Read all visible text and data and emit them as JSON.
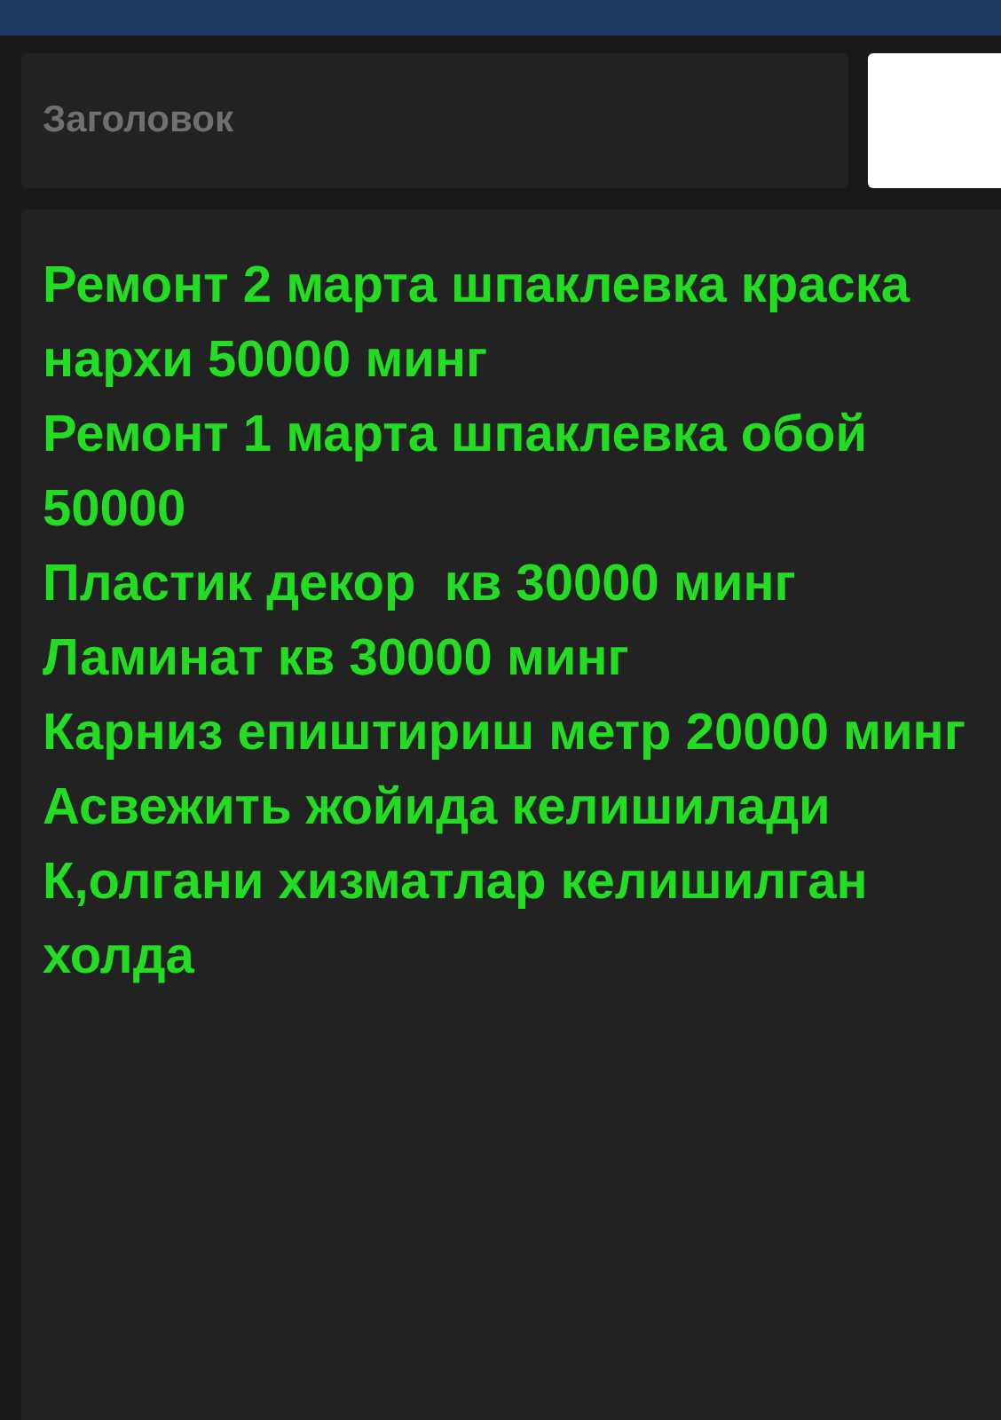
{
  "title_field": {
    "placeholder": "Заголовок"
  },
  "note": {
    "lines": [
      "Ремонт 2 марта шпаклевка краска нархи 50000 минг",
      "Ремонт 1 марта шпаклевка обой 50000",
      "Пластик декор  кв 30000 минг",
      "Ламинат кв 30000 минг",
      "Карниз епиштириш метр 20000 минг",
      "Асвежить жойида келишилади",
      "К,олгани хизматлар келишилган холда"
    ],
    "color": "#22dd22"
  }
}
